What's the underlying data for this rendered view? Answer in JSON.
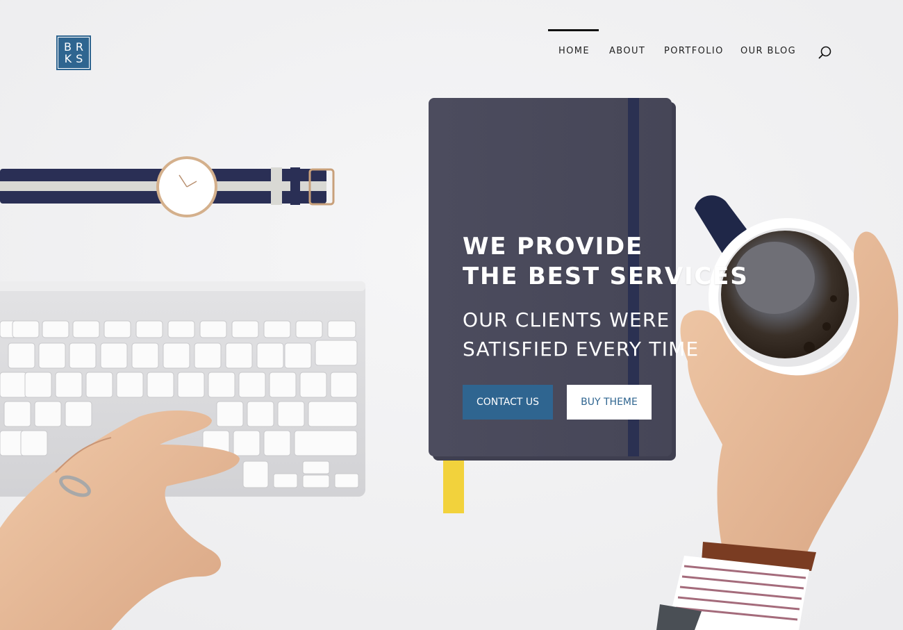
{
  "logo": {
    "line1": "BR",
    "line2": "KS",
    "color": "#2f6590"
  },
  "nav": {
    "items": [
      {
        "label": "HOME",
        "active": true
      },
      {
        "label": "ABOUT",
        "active": false
      },
      {
        "label": "PORTFOLIO",
        "active": false
      },
      {
        "label": "OUR BLOG",
        "active": false
      }
    ],
    "search_icon": "search-icon"
  },
  "hero": {
    "title_line1": "WE PROVIDE",
    "title_line2": "THE BEST SERVICES",
    "subtitle_line1": "OUR CLIENTS WERE",
    "subtitle_line2": "SATISFIED EVERY TIME",
    "primary_button": "CONTACT US",
    "secondary_button": "BUY THEME"
  },
  "colors": {
    "accent": "#2f6590",
    "notebook": "#4a4a5c",
    "background": "#f2f2f2"
  }
}
